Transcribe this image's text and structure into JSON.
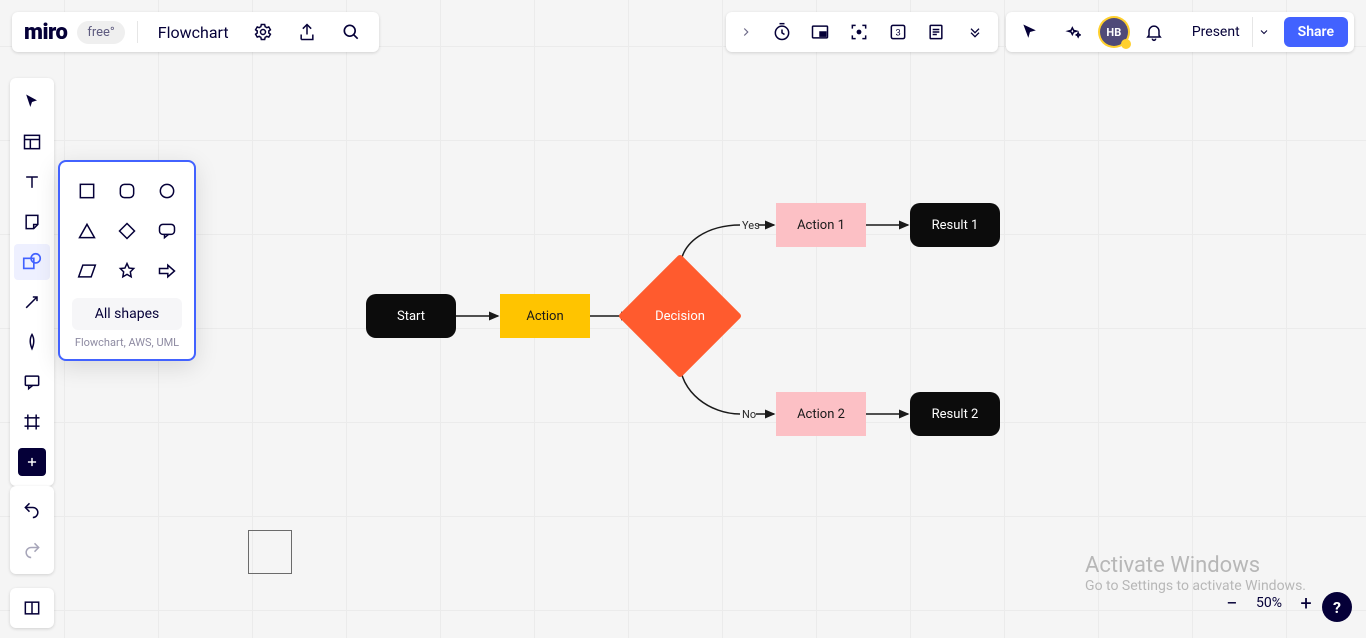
{
  "app": {
    "logo": "miro",
    "plan_badge": "free°"
  },
  "board": {
    "name": "Flowchart"
  },
  "header_right": {
    "avatar_initials": "HB",
    "present_label": "Present",
    "share_label": "Share"
  },
  "header_center_icons": {
    "expand": "chevron-right",
    "timer": "timer",
    "hide": "hide-frame",
    "focus": "focus",
    "voting": "voting",
    "notes": "notes",
    "more": "more"
  },
  "left_toolbar": {
    "items": [
      "select",
      "templates",
      "text",
      "sticky",
      "shapes",
      "connector",
      "pen",
      "comment",
      "frame"
    ],
    "add": "+"
  },
  "popover": {
    "shapes": [
      "square",
      "rounded",
      "circle",
      "triangle",
      "diamond",
      "speech",
      "parallelogram",
      "star",
      "arrow"
    ],
    "all_shapes_label": "All shapes",
    "subtext": "Flowchart, AWS, UML"
  },
  "flowchart": {
    "start": "Start",
    "action": "Action",
    "decision": "Decision",
    "action1": "Action 1",
    "action2": "Action 2",
    "result1": "Result 1",
    "result2": "Result 2",
    "yes": "Yes",
    "no": "No"
  },
  "zoom": {
    "percent": "50%"
  },
  "watermark": {
    "line1": "Activate Windows",
    "line2": "Go to Settings to activate Windows."
  },
  "help": {
    "label": "?"
  }
}
